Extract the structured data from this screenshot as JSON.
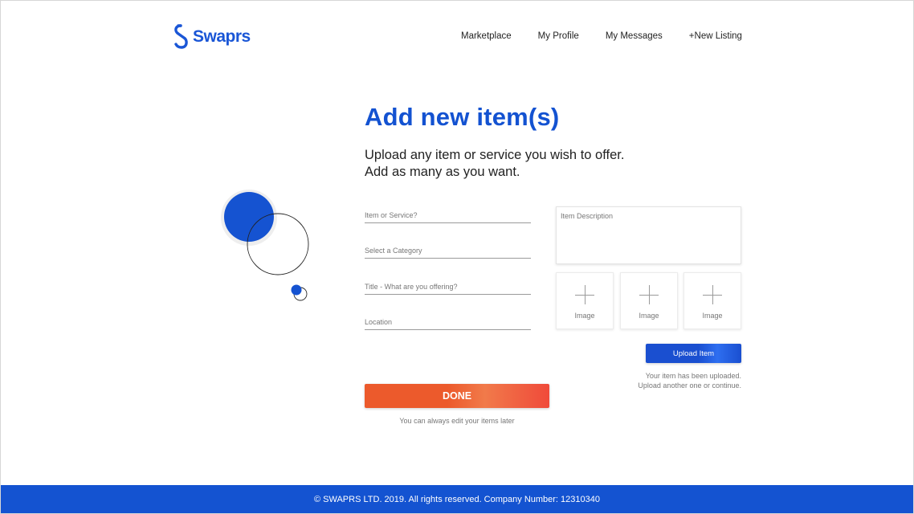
{
  "brand": {
    "name": "Swaprs",
    "color": "#1a56d6"
  },
  "nav": {
    "items": [
      {
        "label": "Marketplace"
      },
      {
        "label": "My Profile"
      },
      {
        "label": "My Messages"
      },
      {
        "label": "+New Listing"
      }
    ]
  },
  "hero": {
    "title": "Add new item(s)",
    "subtitle_line1": "Upload any item or service you wish to offer.",
    "subtitle_line2": "Add as many as you want."
  },
  "form": {
    "item_or_service_placeholder": "Item or Service?",
    "category_placeholder": "Select a Category",
    "title_placeholder": "Title - What are you offering?",
    "location_placeholder": "Location",
    "description_placeholder": "Item Description",
    "image_slots": [
      {
        "label": "Image"
      },
      {
        "label": "Image"
      },
      {
        "label": "Image"
      }
    ],
    "upload_button": "Upload Item",
    "upload_message_line1": "Your item has been uploaded.",
    "upload_message_line2": "Upload another one or continue.",
    "done_button": "DONE",
    "done_note": "You can always edit your items later"
  },
  "footer": {
    "text": "© SWAPRS LTD. 2019. All rights reserved. Company Number: 12310340"
  },
  "colors": {
    "primary": "#1453d1",
    "accent": "#ec5a2c",
    "footer_bg": "#1453d1"
  }
}
